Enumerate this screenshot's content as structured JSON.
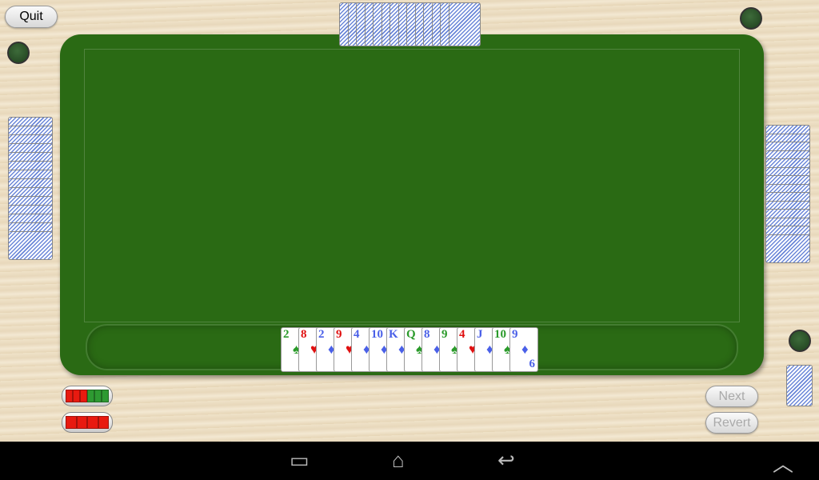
{
  "buttons": {
    "quit": "Quit",
    "next": "Next",
    "revert": "Revert"
  },
  "colors": {
    "felt": "#2a6a14",
    "spades": "#2a9a2a",
    "hearts": "#e01010",
    "diamonds": "#4a60e8"
  },
  "hand": [
    {
      "rank": "2",
      "suit": "spades",
      "glyph": "♠"
    },
    {
      "rank": "8",
      "suit": "hearts",
      "glyph": "♥"
    },
    {
      "rank": "2",
      "suit": "diamonds",
      "glyph": "♦"
    },
    {
      "rank": "9",
      "suit": "hearts",
      "glyph": "♥"
    },
    {
      "rank": "4",
      "suit": "diamonds",
      "glyph": "♦"
    },
    {
      "rank": "10",
      "suit": "diamonds",
      "glyph": "♦"
    },
    {
      "rank": "K",
      "suit": "diamonds",
      "glyph": "♦"
    },
    {
      "rank": "Q",
      "suit": "spades",
      "glyph": "♠"
    },
    {
      "rank": "8",
      "suit": "diamonds",
      "glyph": "♦"
    },
    {
      "rank": "9",
      "suit": "spades",
      "glyph": "♠"
    },
    {
      "rank": "4",
      "suit": "hearts",
      "glyph": "♥"
    },
    {
      "rank": "J",
      "suit": "diamonds",
      "glyph": "♦"
    },
    {
      "rank": "10",
      "suit": "spades",
      "glyph": "♠"
    },
    {
      "rank": "9",
      "suit": "diamonds",
      "glyph": "♦",
      "bottom": "6"
    }
  ],
  "opponents": {
    "top_cards": 14,
    "left_cards": 14,
    "right_cards": 14
  },
  "meters": [
    [
      "red",
      "red",
      "red",
      "green",
      "green",
      "green"
    ],
    [
      "red",
      "red",
      "red",
      "red"
    ]
  ],
  "nav": {
    "back": "back-icon",
    "home": "home-icon",
    "recents": "recents-icon",
    "up": "chevron-up-icon"
  }
}
